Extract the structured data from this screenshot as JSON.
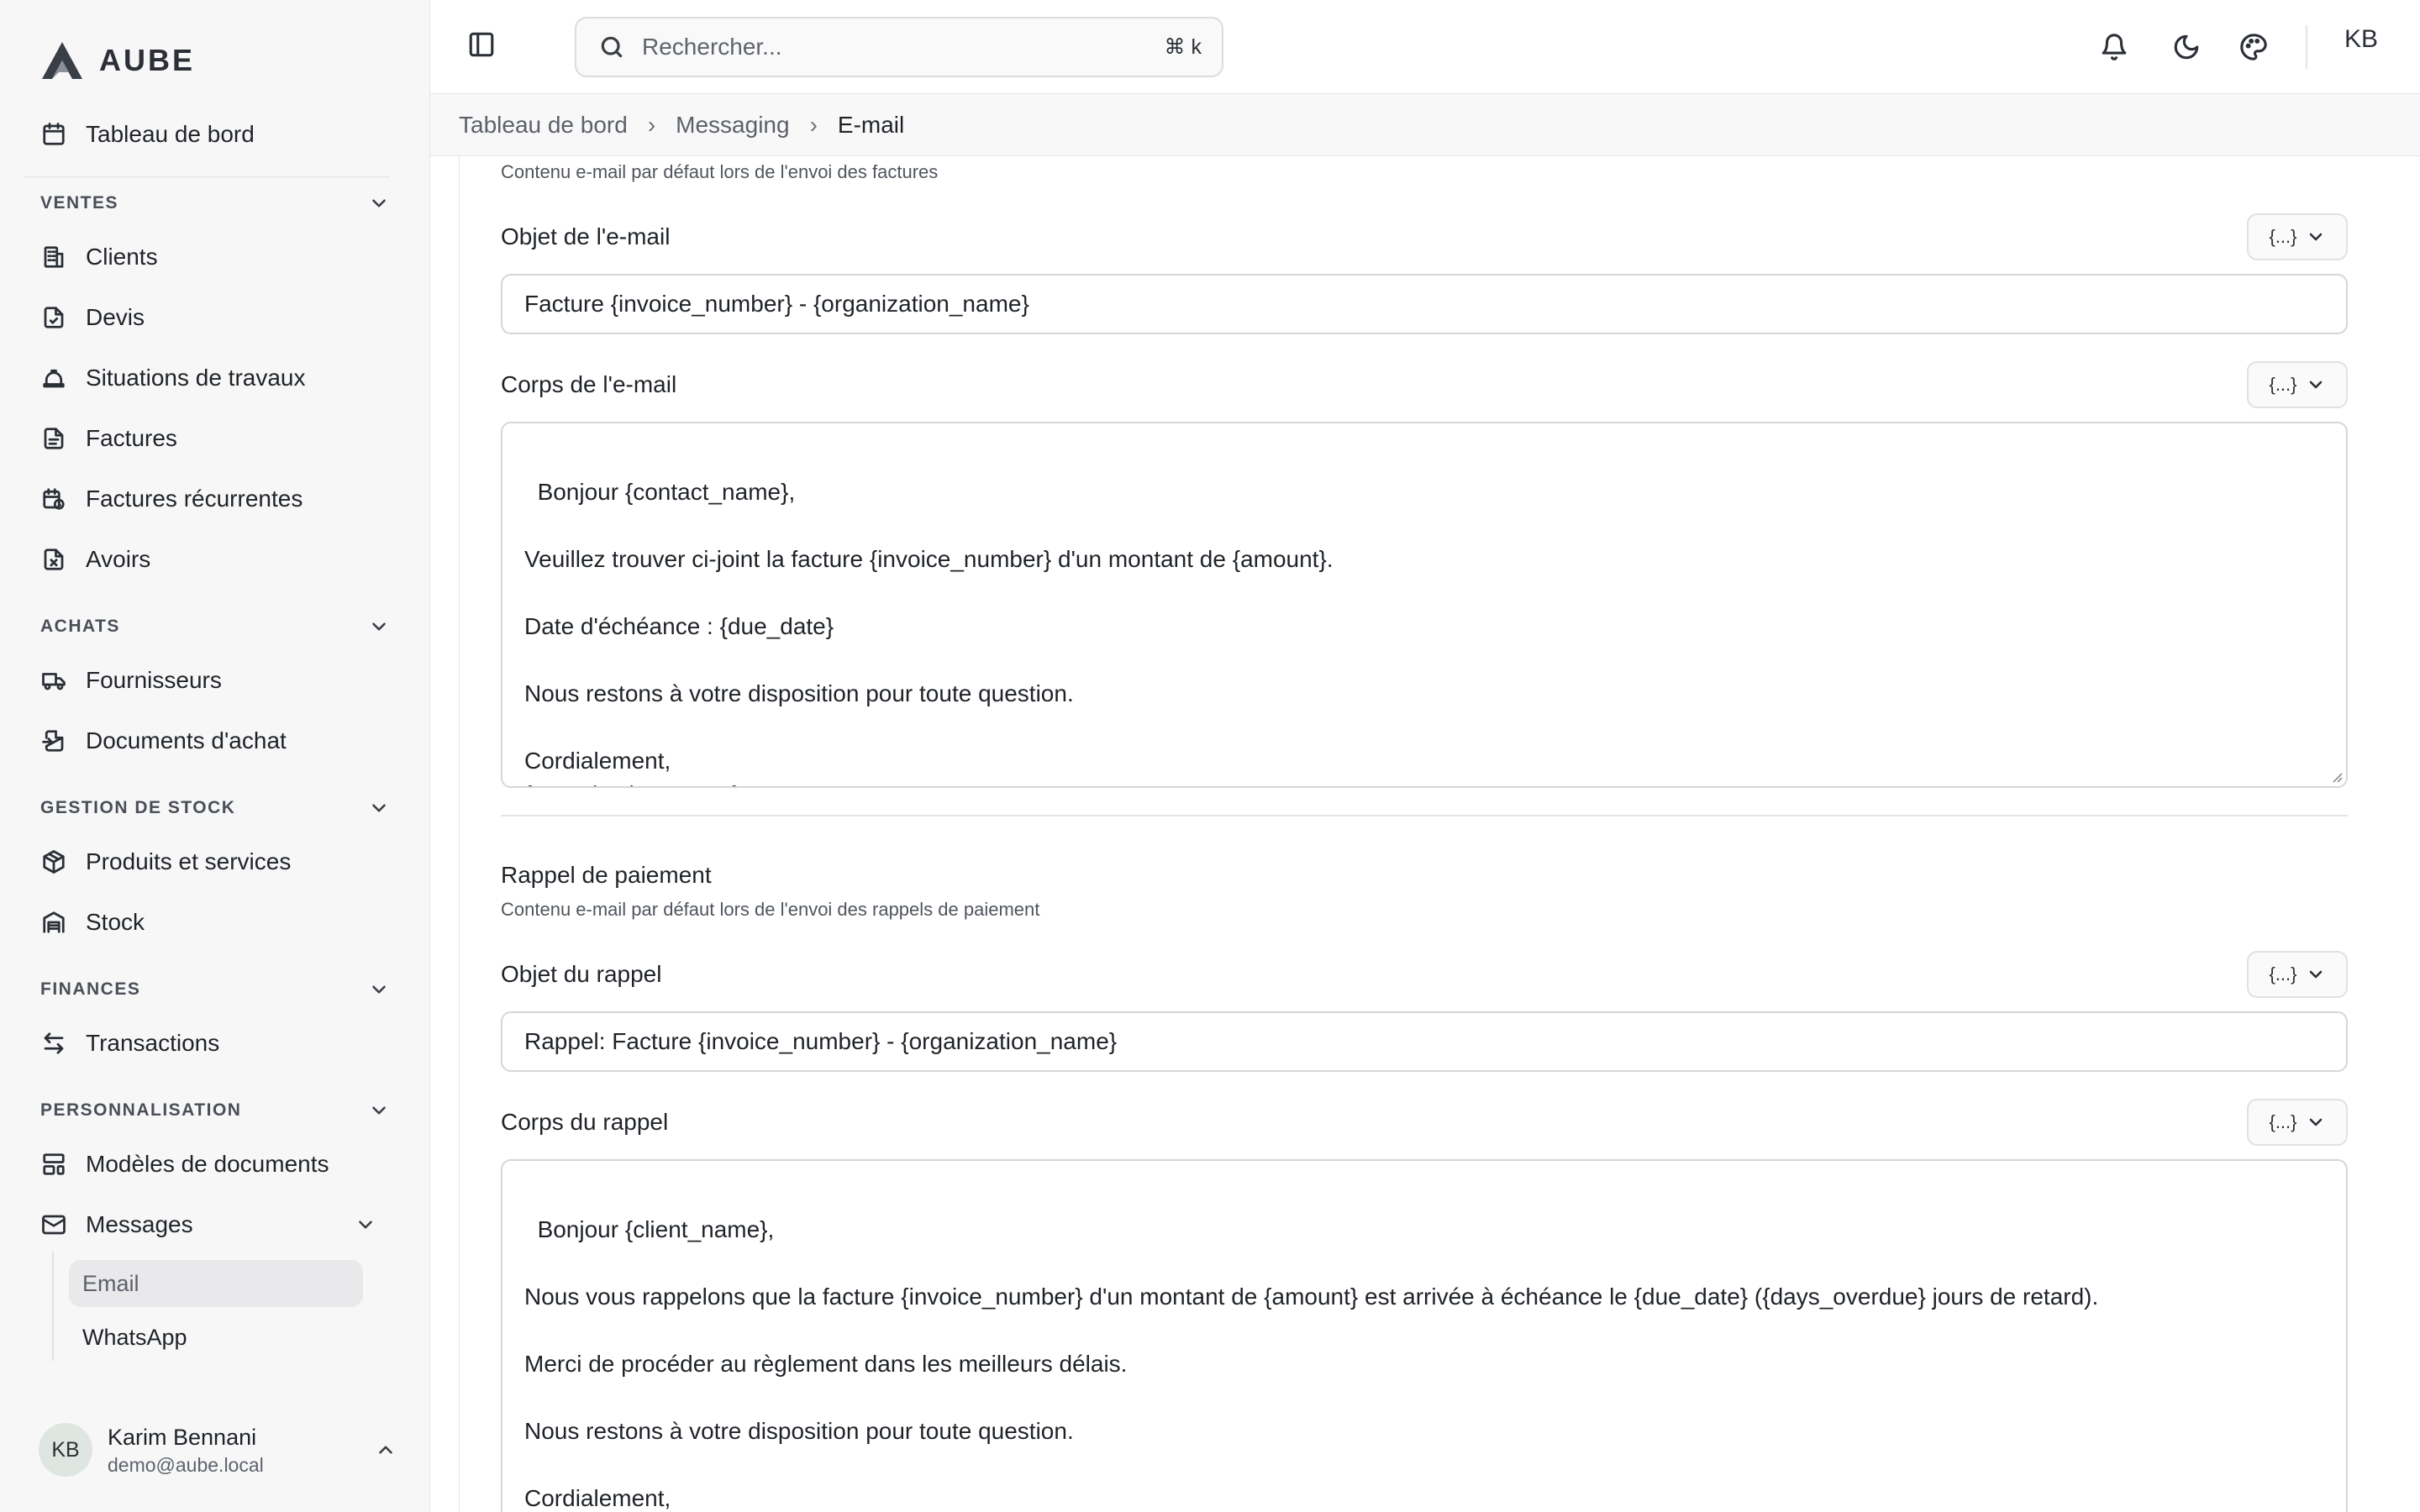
{
  "app": {
    "name": "AUBE"
  },
  "sidebar": {
    "dashboard": "Tableau de bord",
    "sections": {
      "ventes": "VENTES",
      "achats": "ACHATS",
      "stock": "GESTION DE STOCK",
      "finances": "FINANCES",
      "perso": "PERSONNALISATION"
    },
    "items": {
      "clients": "Clients",
      "devis": "Devis",
      "situations": "Situations de travaux",
      "factures": "Factures",
      "factures_recurrentes": "Factures récurrentes",
      "avoirs": "Avoirs",
      "fournisseurs": "Fournisseurs",
      "documents_achat": "Documents d'achat",
      "produits": "Produits et services",
      "stock": "Stock",
      "transactions": "Transactions",
      "modeles": "Modèles de documents",
      "messages": "Messages"
    },
    "sub_items": {
      "email": "Email",
      "whatsapp": "WhatsApp"
    },
    "user": {
      "initials": "KB",
      "name": "Karim Bennani",
      "email": "demo@aube.local"
    }
  },
  "topbar": {
    "search_placeholder": "Rechercher...",
    "shortcut": "⌘ k",
    "user_initials": "KB"
  },
  "breadcrumb": {
    "items": [
      "Tableau de bord",
      "Messaging",
      "E-mail"
    ]
  },
  "main": {
    "invoice": {
      "description": "Contenu e-mail par défaut lors de l'envoi des factures",
      "subject_label": "Objet de l'e-mail",
      "subject_value": "Facture {invoice_number} - {organization_name}",
      "body_label": "Corps de l'e-mail",
      "body_value": "Bonjour {contact_name},\n\nVeuillez trouver ci-joint la facture {invoice_number} d'un montant de {amount}.\n\nDate d'échéance : {due_date}\n\nNous restons à votre disposition pour toute question.\n\nCordialement,\n{organization_name}"
    },
    "reminder": {
      "title": "Rappel de paiement",
      "description": "Contenu e-mail par défaut lors de l'envoi des rappels de paiement",
      "subject_label": "Objet du rappel",
      "subject_value": "Rappel: Facture {invoice_number} - {organization_name}",
      "body_label": "Corps du rappel",
      "body_value": "Bonjour {client_name},\n\nNous vous rappelons que la facture {invoice_number} d'un montant de {amount} est arrivée à échéance le {due_date} ({days_overdue} jours de retard).\n\nMerci de procéder au règlement dans les meilleurs délais.\n\nNous restons à votre disposition pour toute question.\n\nCordialement,\n{organization_name}"
    },
    "variable_button_label": "{...}"
  }
}
